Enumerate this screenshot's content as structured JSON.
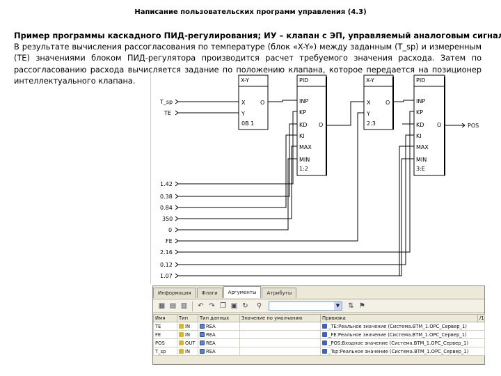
{
  "slide": {
    "title": "Написание пользовательских программ управления (4.3)",
    "subtitle": "Пример программы каскадного ПИД-регулирования; ИУ – клапан с ЭП, управляемый аналоговым сигналом",
    "paragraph": "В результате вычисления рассогласования по температуре (блок «X-Y») между заданным (T_sp) и измеренным (TE) значениями блоком ПИД-регулятора производится расчет требуемого значения расхода. Затем по рассогласованию расхода вычисляется задание по положению клапана, которое передается на позиционер интеллектуального клапана."
  },
  "diagram": {
    "inputs": [
      "T_sp",
      "TE"
    ],
    "constants": [
      "1.42",
      "0.38",
      "0.84",
      "350",
      "0",
      "FE",
      "2.16",
      "0.12",
      "1.07"
    ],
    "blocks": [
      {
        "title": "X-Y",
        "ports_in": [
          "X",
          "Y"
        ],
        "port_out": "O",
        "id": "0B 1"
      },
      {
        "title": "PID",
        "ports_in": [
          "INP",
          "KP",
          "KD",
          "KI",
          "MAX",
          "MIN"
        ],
        "port_out": "O",
        "id": "1:2"
      },
      {
        "title": "X-Y",
        "ports_in": [
          "X",
          "Y"
        ],
        "port_out": "O",
        "id": "2:3"
      },
      {
        "title": "PID",
        "ports_in": [
          "INP",
          "KP",
          "KD",
          "KI",
          "MAX",
          "MIN"
        ],
        "port_out": "O",
        "id": "3:E"
      }
    ],
    "output": "POS"
  },
  "panel": {
    "tabs": [
      "Информация",
      "Флаги",
      "Аргументы",
      "Атрибуты"
    ],
    "active_tab": "Аргументы",
    "columns": [
      "Имя",
      "Тип",
      "Тип данных",
      "Значение по умолчанию",
      "Привязка"
    ],
    "column_extra": "/1",
    "rows": [
      {
        "name": "TE",
        "type": "IN",
        "dtype": "REA",
        "default": "",
        "binding": "_TE:Реальное значение (Система.BTM_1.OPC_Сервер_1)"
      },
      {
        "name": "FE",
        "type": "IN",
        "dtype": "REA",
        "default": "",
        "binding": "_FE:Реальное значение (Система.BTM_1.OPC_Сервер_1)"
      },
      {
        "name": "POS",
        "type": "OUT",
        "dtype": "REA",
        "default": "",
        "binding": "_POS:Входное значение (Система.BTM_1.OPC_Сервер_1)"
      },
      {
        "name": "T_sp",
        "type": "IN",
        "dtype": "REA",
        "default": "",
        "binding": "_Tsp:Реальное значение (Система.BTM_1.OPC_Сервер_1)"
      }
    ]
  }
}
